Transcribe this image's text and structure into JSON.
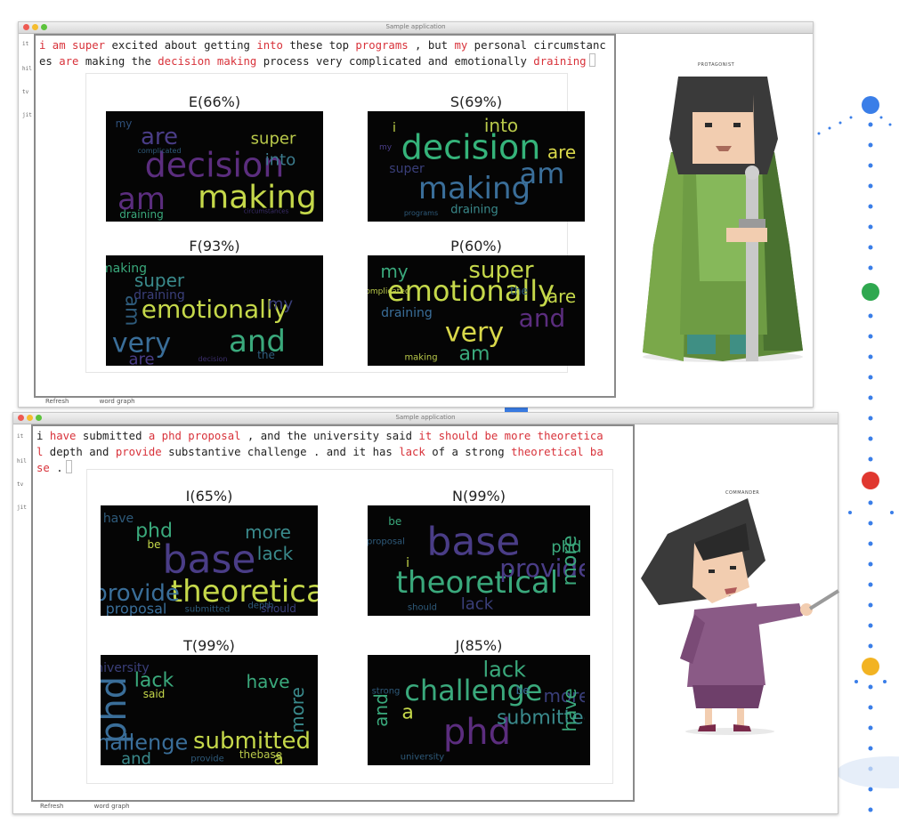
{
  "windows": [
    {
      "title": "Sample application",
      "gutter_lines": [
        "it",
        "hil",
        "tv",
        "jit"
      ],
      "sentence": [
        {
          "t": "i am",
          "h": true
        },
        {
          "t": " ",
          "h": false
        },
        {
          "t": "super",
          "h": true
        },
        {
          "t": " excited about getting ",
          "h": false
        },
        {
          "t": "into",
          "h": true
        },
        {
          "t": " these top ",
          "h": false
        },
        {
          "t": "programs",
          "h": true
        },
        {
          "t": " , but ",
          "h": false
        },
        {
          "t": "my",
          "h": true
        },
        {
          "t": " personal circumstanc\nes ",
          "h": false
        },
        {
          "t": "are",
          "h": true
        },
        {
          "t": " making the ",
          "h": false
        },
        {
          "t": "decision making",
          "h": true
        },
        {
          "t": " process very complicated and emotionally ",
          "h": false
        },
        {
          "t": "draining",
          "h": true
        }
      ],
      "clouds": [
        {
          "label": "E(66%)",
          "words": [
            {
              "w": "decision",
              "c": "#5b2d7e",
              "s": 38,
              "r": 0
            },
            {
              "w": "making",
              "c": "#c5d84a",
              "s": 36,
              "r": 0
            },
            {
              "w": "am",
              "c": "#5b2d7e",
              "s": 34,
              "r": 0
            },
            {
              "w": "are",
              "c": "#4a3d87",
              "s": 26,
              "r": 0
            },
            {
              "w": "super",
              "c": "#b9c94a",
              "s": 18,
              "r": 0
            },
            {
              "w": "into",
              "c": "#3b7a8c",
              "s": 18,
              "r": 0
            },
            {
              "w": "draining",
              "c": "#3aa97c",
              "s": 12,
              "r": 0
            },
            {
              "w": "my",
              "c": "#2e4f7a",
              "s": 12,
              "r": 0
            },
            {
              "w": "complicated",
              "c": "#2e5a7a",
              "s": 8,
              "r": 0
            },
            {
              "w": "circumstances",
              "c": "#3b2e6b",
              "s": 7,
              "r": 0
            }
          ]
        },
        {
          "label": "S(69%)",
          "words": [
            {
              "w": "decision",
              "c": "#35b37a",
              "s": 38,
              "r": 0
            },
            {
              "w": "making",
              "c": "#3a6e99",
              "s": 34,
              "r": 0
            },
            {
              "w": "am",
              "c": "#3a6e99",
              "s": 32,
              "r": 0
            },
            {
              "w": "into",
              "c": "#b9c94a",
              "s": 20,
              "r": 0
            },
            {
              "w": "are",
              "c": "#d9d84a",
              "s": 20,
              "r": 0
            },
            {
              "w": "draining",
              "c": "#3a8a8c",
              "s": 13,
              "r": 0
            },
            {
              "w": "i",
              "c": "#c5d84a",
              "s": 14,
              "r": 0
            },
            {
              "w": "super",
              "c": "#3a3f7a",
              "s": 14,
              "r": 0
            },
            {
              "w": "programs",
              "c": "#2e5a7a",
              "s": 8,
              "r": 0
            },
            {
              "w": "my",
              "c": "#4a3d87",
              "s": 9,
              "r": 0
            }
          ]
        },
        {
          "label": "F(93%)",
          "words": [
            {
              "w": "emotionally",
              "c": "#c5d84a",
              "s": 28,
              "r": 0
            },
            {
              "w": "and",
              "c": "#3aa97c",
              "s": 34,
              "r": 0
            },
            {
              "w": "very",
              "c": "#3a6e99",
              "s": 30,
              "r": 0
            },
            {
              "w": "super",
              "c": "#3a8a8c",
              "s": 20,
              "r": 0
            },
            {
              "w": "am",
              "c": "#2e5a7a",
              "s": 22,
              "r": 90
            },
            {
              "w": "my",
              "c": "#3a3f7a",
              "s": 18,
              "r": 0
            },
            {
              "w": "are",
              "c": "#4a3d87",
              "s": 18,
              "r": 0
            },
            {
              "w": "making",
              "c": "#3aa97c",
              "s": 14,
              "r": 0
            },
            {
              "w": "draining",
              "c": "#3a3f7a",
              "s": 14,
              "r": 0
            },
            {
              "w": "the",
              "c": "#2e5a7a",
              "s": 12,
              "r": 0
            },
            {
              "w": "decision",
              "c": "#3b2e6b",
              "s": 8,
              "r": 0
            }
          ]
        },
        {
          "label": "P(60%)",
          "words": [
            {
              "w": "emotionally",
              "c": "#c5d84a",
              "s": 32,
              "r": 0
            },
            {
              "w": "very",
              "c": "#d9d84a",
              "s": 30,
              "r": 0
            },
            {
              "w": "and",
              "c": "#5b2d7e",
              "s": 28,
              "r": 0
            },
            {
              "w": "super",
              "c": "#c5d84a",
              "s": 26,
              "r": 0
            },
            {
              "w": "are",
              "c": "#c5d84a",
              "s": 20,
              "r": 0
            },
            {
              "w": "am",
              "c": "#3aa97c",
              "s": 22,
              "r": 0
            },
            {
              "w": "my",
              "c": "#3aa97c",
              "s": 20,
              "r": 0
            },
            {
              "w": "draining",
              "c": "#3a6e99",
              "s": 14,
              "r": 0
            },
            {
              "w": "making",
              "c": "#b9c94a",
              "s": 10,
              "r": 0
            },
            {
              "w": "complicated",
              "c": "#b9c94a",
              "s": 9,
              "r": 0
            },
            {
              "w": "the",
              "c": "#2e5a7a",
              "s": 12,
              "r": 0
            }
          ]
        }
      ],
      "status": [
        "Refresh",
        "word graph"
      ]
    },
    {
      "title": "Sample application",
      "gutter_lines": [
        "it",
        "hil",
        "tv",
        "jit"
      ],
      "sentence": [
        {
          "t": "i",
          "h": false
        },
        {
          "t": " ",
          "h": false
        },
        {
          "t": "have",
          "h": true
        },
        {
          "t": " submitted ",
          "h": false
        },
        {
          "t": "a phd proposal",
          "h": true
        },
        {
          "t": " , and the university said ",
          "h": false
        },
        {
          "t": "it should be more theoretica\nl",
          "h": true
        },
        {
          "t": " depth and ",
          "h": false
        },
        {
          "t": "provide",
          "h": true
        },
        {
          "t": " substantive challenge . and it has ",
          "h": false
        },
        {
          "t": "lack",
          "h": true
        },
        {
          "t": " of a strong ",
          "h": false
        },
        {
          "t": "theoretical ba\nse",
          "h": true
        },
        {
          "t": " .",
          "h": false
        }
      ],
      "clouds": [
        {
          "label": "I(65%)",
          "words": [
            {
              "w": "base",
              "c": "#4a3d87",
              "s": 44,
              "r": 0
            },
            {
              "w": "theoretical",
              "c": "#c5d84a",
              "s": 34,
              "r": 0
            },
            {
              "w": "provide",
              "c": "#3a6e99",
              "s": 26,
              "r": 0
            },
            {
              "w": "phd",
              "c": "#3aa97c",
              "s": 22,
              "r": 0
            },
            {
              "w": "more",
              "c": "#3a8a8c",
              "s": 20,
              "r": 0
            },
            {
              "w": "lack",
              "c": "#3a8a8c",
              "s": 20,
              "r": 0
            },
            {
              "w": "proposal",
              "c": "#3a6e99",
              "s": 16,
              "r": 0
            },
            {
              "w": "have",
              "c": "#2e5a7a",
              "s": 14,
              "r": 0
            },
            {
              "w": "be",
              "c": "#c5d84a",
              "s": 12,
              "r": 0
            },
            {
              "w": "depth",
              "c": "#2e5a7a",
              "s": 10,
              "r": 0
            },
            {
              "w": "submitted",
              "c": "#2e5a7a",
              "s": 10,
              "r": 0
            },
            {
              "w": "should",
              "c": "#3a3f7a",
              "s": 12,
              "r": 0
            }
          ]
        },
        {
          "label": "N(99%)",
          "words": [
            {
              "w": "base",
              "c": "#4a3d87",
              "s": 44,
              "r": 0
            },
            {
              "w": "theoretical",
              "c": "#3aa97c",
              "s": 34,
              "r": 0
            },
            {
              "w": "provide",
              "c": "#4a3d87",
              "s": 28,
              "r": 0
            },
            {
              "w": "more",
              "c": "#3aa97c",
              "s": 22,
              "r": -90
            },
            {
              "w": "phd",
              "c": "#3aa97c",
              "s": 18,
              "r": 0
            },
            {
              "w": "lack",
              "c": "#3a3f7a",
              "s": 18,
              "r": 0
            },
            {
              "w": "be",
              "c": "#3aa97c",
              "s": 12,
              "r": 0
            },
            {
              "w": "i",
              "c": "#c5d84a",
              "s": 14,
              "r": 0
            },
            {
              "w": "should",
              "c": "#2e5a7a",
              "s": 10,
              "r": 0
            },
            {
              "w": "proposal",
              "c": "#2e5a7a",
              "s": 10,
              "r": 0
            }
          ]
        },
        {
          "label": "T(99%)",
          "words": [
            {
              "w": "phd",
              "c": "#3a6e99",
              "s": 40,
              "r": -90
            },
            {
              "w": "submitted",
              "c": "#c5d84a",
              "s": 26,
              "r": 0
            },
            {
              "w": "challenge",
              "c": "#3a6e99",
              "s": 24,
              "r": 0
            },
            {
              "w": "lack",
              "c": "#3aa97c",
              "s": 22,
              "r": 0
            },
            {
              "w": "have",
              "c": "#3aa97c",
              "s": 20,
              "r": 0
            },
            {
              "w": "more",
              "c": "#3a8a8c",
              "s": 20,
              "r": -90
            },
            {
              "w": "and",
              "c": "#3a8a8c",
              "s": 18,
              "r": 0
            },
            {
              "w": "university",
              "c": "#3a3f7a",
              "s": 14,
              "r": 0
            },
            {
              "w": "said",
              "c": "#c5d84a",
              "s": 12,
              "r": 0
            },
            {
              "w": "thebase",
              "c": "#b9c94a",
              "s": 12,
              "r": 0
            },
            {
              "w": "provide",
              "c": "#2e5a7a",
              "s": 10,
              "r": 0
            },
            {
              "w": "a",
              "c": "#c5d84a",
              "s": 18,
              "r": 0
            }
          ]
        },
        {
          "label": "J(85%)",
          "words": [
            {
              "w": "challenge",
              "c": "#3aa97c",
              "s": 32,
              "r": 0
            },
            {
              "w": "phd",
              "c": "#5b2d7e",
              "s": 40,
              "r": 0
            },
            {
              "w": "submitted",
              "c": "#3a8a8c",
              "s": 22,
              "r": 0
            },
            {
              "w": "lack",
              "c": "#3aa97c",
              "s": 24,
              "r": 0
            },
            {
              "w": "more",
              "c": "#3a3f7a",
              "s": 20,
              "r": 0
            },
            {
              "w": "have",
              "c": "#3aa97c",
              "s": 20,
              "r": -90
            },
            {
              "w": "and",
              "c": "#3aa97c",
              "s": 20,
              "r": -90
            },
            {
              "w": "a",
              "c": "#c5d84a",
              "s": 22,
              "r": 0
            },
            {
              "w": "university",
              "c": "#2e5a7a",
              "s": 10,
              "r": 0
            },
            {
              "w": "strong",
              "c": "#2e5a7a",
              "s": 10,
              "r": 0
            },
            {
              "w": "be",
              "c": "#3a6e99",
              "s": 12,
              "r": 0
            }
          ]
        }
      ],
      "status": [
        "Refresh",
        "word graph"
      ]
    }
  ],
  "characters": {
    "top_caption": "PROTAGONIST",
    "bottom_caption": "COMMANDER"
  },
  "dots": {
    "colors": [
      "#3a7ee8",
      "#2fa84f",
      "#e0372f",
      "#f2b322"
    ]
  }
}
